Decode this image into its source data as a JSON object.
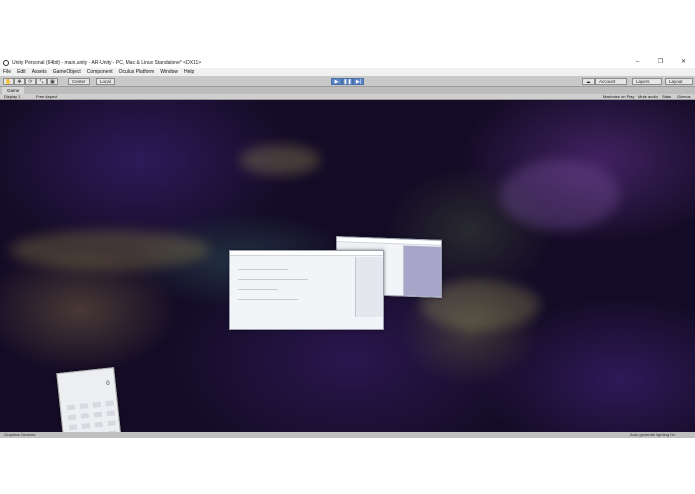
{
  "window": {
    "title": "Unity Personal (64bit) - main.unity - AR-Unity - PC, Mac & Linux Standalone* <DX11>",
    "controls": [
      "–",
      "❐",
      "✕"
    ]
  },
  "menu": [
    "File",
    "Edit",
    "Assets",
    "GameObject",
    "Component",
    "Oculus Platform",
    "Window",
    "Help"
  ],
  "toolbar": {
    "tools": [
      "hand-tool",
      "move-tool",
      "rotate-tool",
      "scale-tool",
      "rect-tool"
    ],
    "tool_glyphs": [
      "✋",
      "✥",
      "⟳",
      "⤡",
      "▣"
    ],
    "pivot": "Center",
    "space": "Local",
    "play_glyphs": [
      "▶",
      "❚❚",
      "▶|"
    ],
    "account": "Account",
    "layers": "Layers",
    "layout": "Layout"
  },
  "game_tab": {
    "label": "Game",
    "display": "Display 1",
    "aspect": "Free Aspect",
    "options": [
      "Maximize on Play",
      "Mute audio",
      "Stats",
      "Gizmos"
    ]
  },
  "status": {
    "left": "Graphics Devices",
    "right": "Auto generate lighting On"
  },
  "calculator": {
    "display": "0"
  },
  "colors": {
    "play_active": "#5b86c5",
    "space_bg": "#140c26"
  }
}
